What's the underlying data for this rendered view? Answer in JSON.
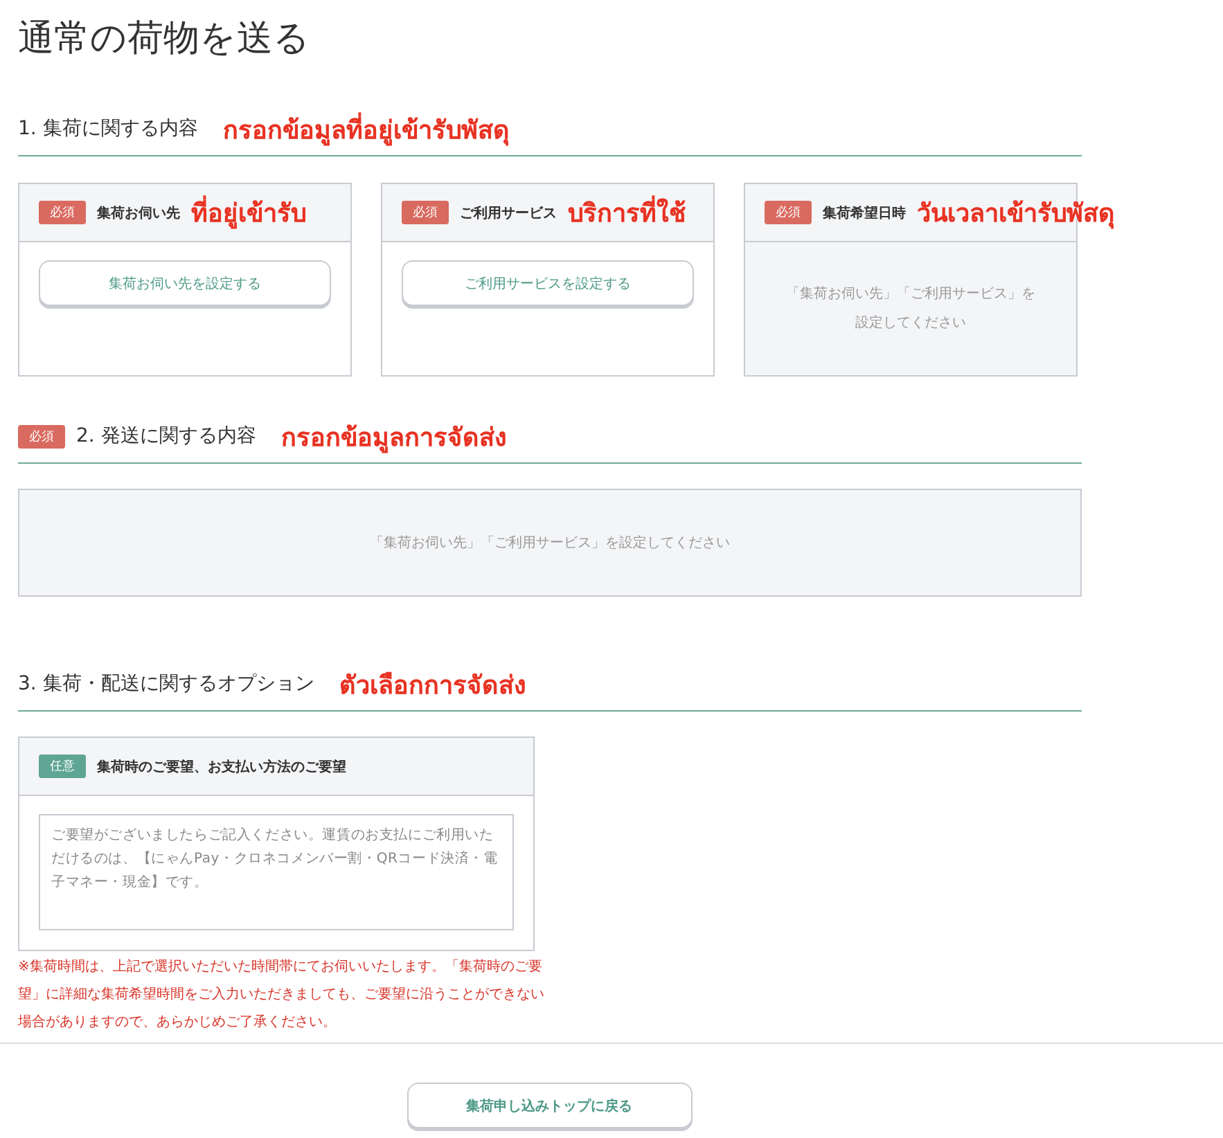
{
  "page_title": "通常の荷物を送る",
  "sections": [
    {
      "heading": "1. 集荷に関する内容",
      "annotation": "กรอกข้อมูลที่อยู่เข้ารับพัสดุ",
      "kind": "cards",
      "cards": [
        {
          "badge": {
            "label": "必須",
            "kind": "required"
          },
          "title": "集荷お伺い先",
          "annotation": "ที่อยู่เข้ารับ",
          "kind": "button",
          "content": "集荷お伺い先を設定する"
        },
        {
          "badge": {
            "label": "必須",
            "kind": "required"
          },
          "title": "ご利用サービス",
          "annotation": "บริการที่ใช้",
          "kind": "button",
          "content": "ご利用サービスを設定する"
        },
        {
          "badge": {
            "label": "必須",
            "kind": "required"
          },
          "title": "集荷希望日時",
          "annotation": "วันเวลาเข้ารับพัสดุ",
          "kind": "message",
          "content": "「集荷お伺い先」「ご利用サービス」を設定してください"
        }
      ]
    },
    {
      "heading": "2. 発送に関する内容",
      "badge": {
        "label": "必須",
        "kind": "required"
      },
      "annotation": "กรอกข้อมูลการจัดส่ง",
      "kind": "message",
      "message": "「集荷お伺い先」「ご利用サービス」を設定してください"
    },
    {
      "heading": "3. 集荷・配送に関するオプション",
      "annotation": "ตัวเลือกการจัดส่ง",
      "kind": "request",
      "card": {
        "badge": {
          "label": "任意",
          "kind": "optional"
        },
        "title": "集荷時のご要望、お支払い方法のご要望",
        "placeholder": "ご要望がございましたらご記入ください。運賃のお支払にご利用いただけるのは、【にゃんPay・クロネコメンバー割・QRコード決済・電子マネー・現金】です。"
      },
      "note": "※集荷時間は、上記で選択いただいた時間帯にてお伺いいたします。「集荷時のご要望」に詳細な集荷希望時間をご入力いただきましても、ご要望に沿うことができない場合がありますので、あらかじめご了承ください。"
    }
  ],
  "back_button": "集荷申し込みトップに戻る"
}
